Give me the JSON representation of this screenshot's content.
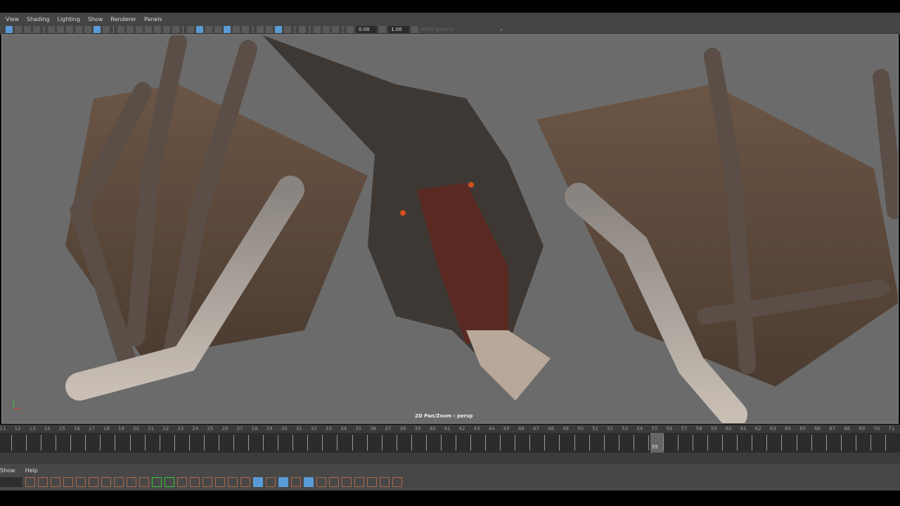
{
  "menu": [
    "View",
    "Shading",
    "Lighting",
    "Show",
    "Renderer",
    "Panels"
  ],
  "toolbar": {
    "exposure": "0.00",
    "gamma": "1.00",
    "color_space": "sRGB gamma"
  },
  "viewport": {
    "label": "2D Pan/Zoom : persp"
  },
  "timeline": {
    "start": 11,
    "end": 71,
    "current": 55,
    "current_label": "55"
  },
  "graph_editor": {
    "menu": [
      "Show",
      "Help"
    ]
  },
  "colors": {
    "accent": "#5b9bd5",
    "viewport_bg": "#6b6b6b"
  }
}
